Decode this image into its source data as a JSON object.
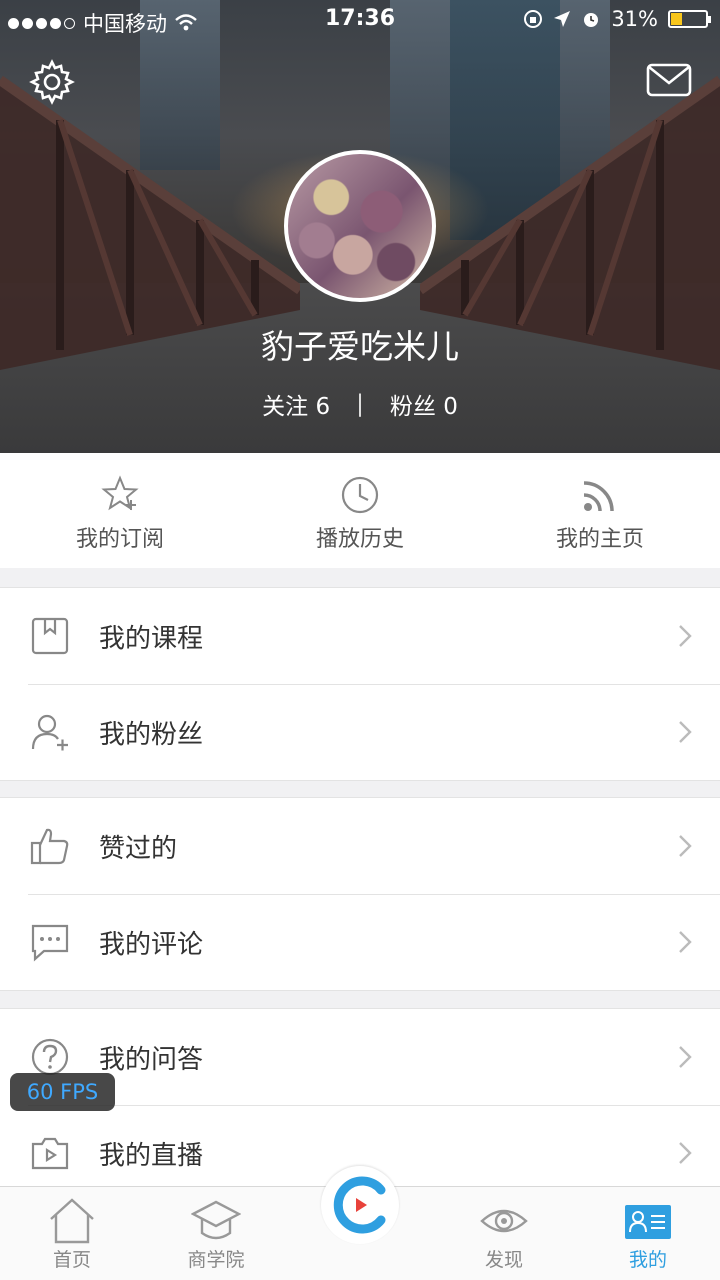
{
  "status_bar": {
    "carrier": "中国移动",
    "time": "17:36",
    "battery": "31%",
    "battery_level": 0.31
  },
  "profile": {
    "username": "豹子爱吃米儿",
    "following_label": "关注",
    "following_count": "6",
    "fans_label": "粉丝",
    "fans_count": "0",
    "separator": "|"
  },
  "quick_actions": [
    {
      "label": "我的订阅",
      "icon": "star-plus-icon"
    },
    {
      "label": "播放历史",
      "icon": "clock-icon"
    },
    {
      "label": "我的主页",
      "icon": "rss-icon"
    }
  ],
  "menu_groups": [
    [
      {
        "label": "我的课程",
        "icon": "bookmark-icon"
      },
      {
        "label": "我的粉丝",
        "icon": "user-add-icon"
      }
    ],
    [
      {
        "label": "赞过的",
        "icon": "thumbs-up-icon"
      },
      {
        "label": "我的评论",
        "icon": "comment-icon"
      }
    ],
    [
      {
        "label": "我的问答",
        "icon": "question-icon"
      },
      {
        "label": "我的直播",
        "icon": "live-camera-icon"
      }
    ]
  ],
  "fps_overlay": "60 FPS",
  "tab_bar": {
    "items": [
      {
        "label": "首页",
        "icon": "home-icon"
      },
      {
        "label": "商学院",
        "icon": "graduation-cap-icon"
      },
      {
        "label": "",
        "icon": "play-center-icon"
      },
      {
        "label": "发现",
        "icon": "eye-icon"
      },
      {
        "label": "我的",
        "icon": "profile-card-icon",
        "active": true
      }
    ],
    "active_color": "#2f9fe0"
  },
  "colors": {
    "accent": "#2f9fe0",
    "battery": "#f8c61c",
    "fps_text": "#3fa9ff"
  }
}
